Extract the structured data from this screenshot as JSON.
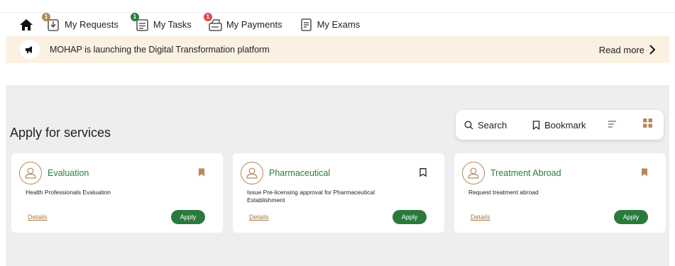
{
  "nav": {
    "items": [
      {
        "label": "My Requests",
        "badge": "1",
        "badge_color": "#b5895a"
      },
      {
        "label": "My Tasks",
        "badge": "1",
        "badge_color": "#2b7a3d"
      },
      {
        "label": "My Payments",
        "badge": "1",
        "badge_color": "#e04b4b"
      },
      {
        "label": "My Exams",
        "badge": "",
        "badge_color": ""
      }
    ]
  },
  "banner": {
    "text": "MOHAP is launching the Digital Transformation platform",
    "read_more": "Read more"
  },
  "services": {
    "title": "Apply for services",
    "toolbar": {
      "search_label": "Search",
      "bookmark_label": "Bookmark"
    },
    "cards": [
      {
        "title": "Evaluation",
        "description": "Health Professionals Evaluation",
        "details_label": "Details",
        "apply_label": "Apply",
        "bookmarked": true
      },
      {
        "title": "Pharmaceutical",
        "description": "Issue Pre-licensing approval for Pharmaceutical Establishment",
        "details_label": "Details",
        "apply_label": "Apply",
        "bookmarked": false
      },
      {
        "title": "Treatment Abroad",
        "description": "Request treatment abroad",
        "details_label": "Details",
        "apply_label": "Apply",
        "bookmarked": true
      }
    ]
  },
  "colors": {
    "brand_green": "#2b7a3d",
    "brand_gold": "#b5895a",
    "banner_bg": "#fbf1e2",
    "section_bg": "#eeeeee"
  }
}
